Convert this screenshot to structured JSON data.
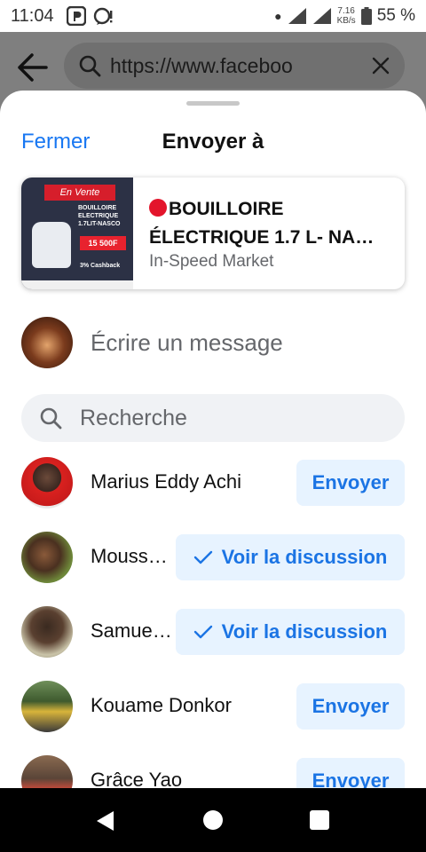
{
  "status_bar": {
    "time": "11:04",
    "net_speed_value": "7.16",
    "net_speed_unit": "KB/s",
    "battery": "55 %"
  },
  "browser": {
    "url": "https://www.faceboo"
  },
  "sheet": {
    "close_label": "Fermer",
    "title": "Envoyer à"
  },
  "shared_post": {
    "title_line1": "BOUILLOIRE",
    "title_line2": "ÉLECTRIQUE 1.7 L- NA…",
    "source": "In-Speed Market",
    "thumbnail": {
      "banner": "En Vente",
      "text": "BOUILLOIRE ELECTRIQUE 1.7LIT-NASCO",
      "price": "15 500F",
      "cashback": "3% Cashback"
    }
  },
  "compose": {
    "placeholder": "Écrire un message"
  },
  "search": {
    "placeholder": "Recherche"
  },
  "contacts": [
    {
      "name": "Marius Eddy Achi",
      "action": "Envoyer",
      "sent": false
    },
    {
      "name": "Mouss…",
      "action": "Voir la discussion",
      "sent": true
    },
    {
      "name": "Samue…",
      "action": "Voir la discussion",
      "sent": true
    },
    {
      "name": "Kouame Donkor",
      "action": "Envoyer",
      "sent": false
    },
    {
      "name": "Grâce Yao",
      "action": "Envoyer",
      "sent": false
    }
  ],
  "colors": {
    "accent": "#1877f2",
    "button_bg": "#e7f3ff",
    "button_text": "#1b74e4",
    "secondary_text": "#65676b"
  }
}
